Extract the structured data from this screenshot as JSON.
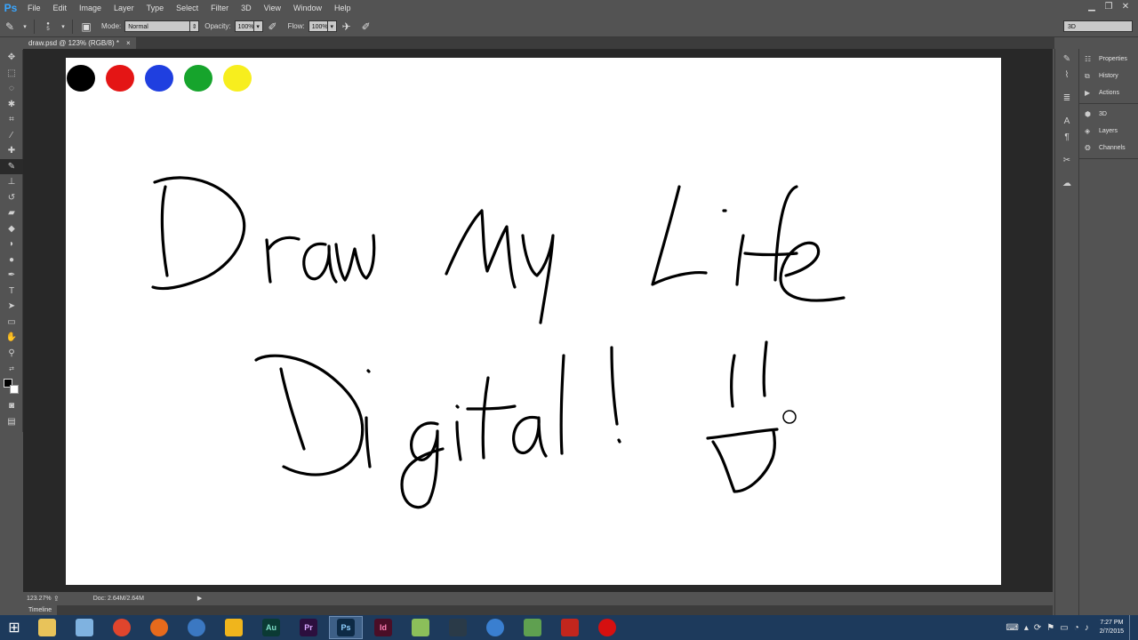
{
  "app": {
    "logo": "Ps",
    "menu": [
      "File",
      "Edit",
      "Image",
      "Layer",
      "Type",
      "Select",
      "Filter",
      "3D",
      "View",
      "Window",
      "Help"
    ],
    "window_controls": [
      "minimize-icon",
      "restore-icon",
      "close-icon"
    ]
  },
  "options": {
    "mode_label": "Mode:",
    "mode_value": "Normal",
    "opacity_label": "Opacity:",
    "opacity_value": "100%",
    "flow_label": "Flow:",
    "flow_value": "100%",
    "brush_size": "5",
    "workspace": "3D"
  },
  "document": {
    "tab_title": "draw.psd @ 123% (RGB/8) *",
    "close_glyph": "×"
  },
  "canvas": {
    "swatches": [
      "#000000",
      "#e41515",
      "#1f3fe0",
      "#16a42c",
      "#f7ee1e"
    ],
    "stroke_color": "#000000"
  },
  "status": {
    "zoom": "123.27%",
    "doc_size": "Doc: 2.64M/2.64M"
  },
  "timeline": {
    "tab_label": "Timeline"
  },
  "panels": {
    "group1": [
      {
        "label": "Properties",
        "icon": "properties-icon"
      },
      {
        "label": "History",
        "icon": "history-icon"
      },
      {
        "label": "Actions",
        "icon": "actions-icon"
      }
    ],
    "group2": [
      {
        "label": "3D",
        "icon": "cube-icon"
      },
      {
        "label": "Layers",
        "icon": "layers-icon"
      },
      {
        "label": "Channels",
        "icon": "channels-icon"
      }
    ]
  },
  "taskbar": {
    "apps": [
      {
        "name": "file-explorer",
        "label": "",
        "color": "#e8c35a"
      },
      {
        "name": "app-2",
        "label": "",
        "color": "#7fb2e0"
      },
      {
        "name": "chrome",
        "label": "",
        "color": "#e0452d"
      },
      {
        "name": "firefox",
        "label": "",
        "color": "#e66a1c"
      },
      {
        "name": "thunderbird",
        "label": "",
        "color": "#3b78c2"
      },
      {
        "name": "app-6",
        "label": "",
        "color": "#f0b51c"
      },
      {
        "name": "audition",
        "label": "Au",
        "color": "#0b3a34"
      },
      {
        "name": "premiere",
        "label": "Pr",
        "color": "#2c0f3e"
      },
      {
        "name": "photoshop",
        "label": "Ps",
        "color": "#0d2a45"
      },
      {
        "name": "indesign",
        "label": "Id",
        "color": "#4a0e27"
      },
      {
        "name": "app-11",
        "label": "",
        "color": "#8bbf5a"
      },
      {
        "name": "app-12",
        "label": "",
        "color": "#2a3a48"
      },
      {
        "name": "itunes",
        "label": "",
        "color": "#3a7fd0"
      },
      {
        "name": "app-14",
        "label": "",
        "color": "#5fa050"
      },
      {
        "name": "filezilla",
        "label": "",
        "color": "#c2261d"
      },
      {
        "name": "recorder",
        "label": "",
        "color": "#d61010"
      }
    ],
    "time": "7:27 PM",
    "date": "2/7/2015"
  }
}
